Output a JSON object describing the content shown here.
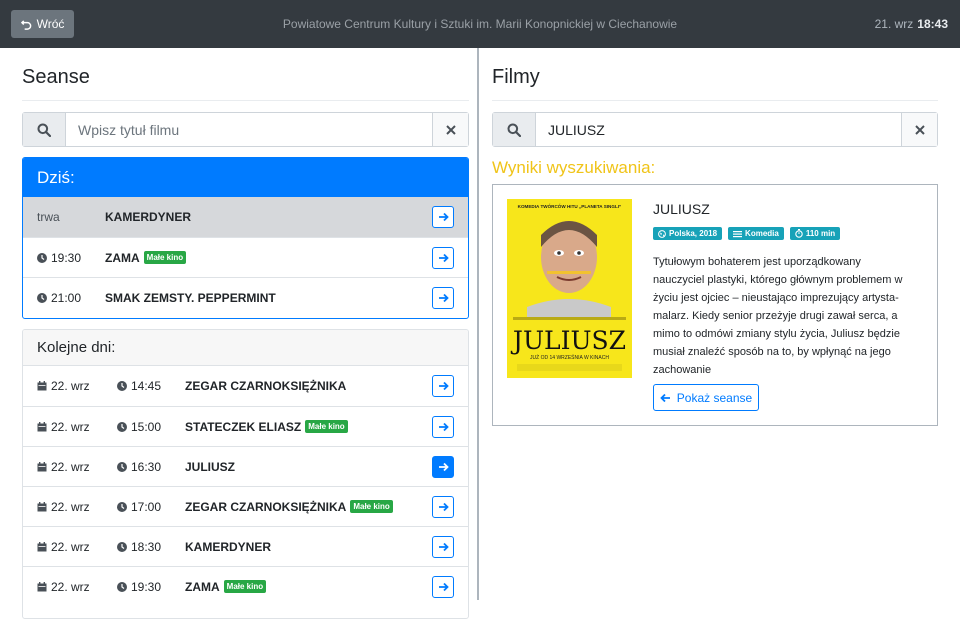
{
  "topbar": {
    "back_label": "Wróć",
    "title": "Powiatowe Centrum Kultury i Sztuki im. Marii Konopnickiej w Ciechanowie",
    "date": "21. wrz",
    "time": "18:43"
  },
  "seanse": {
    "title": "Seanse",
    "search_placeholder": "Wpisz tytuł filmu",
    "today": {
      "header": "Dziś:",
      "rows": [
        {
          "time": "trwa",
          "title": "KAMERDYNER",
          "badge": "",
          "current": true
        },
        {
          "time": "19:30",
          "title": "ZAMA",
          "badge": "Małe kino",
          "current": false
        },
        {
          "time": "21:00",
          "title": "SMAK ZEMSTY. PEPPERMINT",
          "badge": "",
          "current": false
        }
      ]
    },
    "next_days": {
      "header": "Kolejne dni:",
      "rows": [
        {
          "date": "22. wrz",
          "time": "14:45",
          "title": "ZEGAR CZARNOKSIĘŻNIKA",
          "badge": "",
          "active": false
        },
        {
          "date": "22. wrz",
          "time": "15:00",
          "title": "STATECZEK ELIASZ",
          "badge": "Małe kino",
          "active": false
        },
        {
          "date": "22. wrz",
          "time": "16:30",
          "title": "JULIUSZ",
          "badge": "",
          "active": true
        },
        {
          "date": "22. wrz",
          "time": "17:00",
          "title": "ZEGAR CZARNOKSIĘŻNIKA",
          "badge": "Małe kino",
          "active": false
        },
        {
          "date": "22. wrz",
          "time": "18:30",
          "title": "KAMERDYNER",
          "badge": "",
          "active": false
        },
        {
          "date": "22. wrz",
          "time": "19:30",
          "title": "ZAMA",
          "badge": "Małe kino",
          "active": false
        }
      ]
    }
  },
  "filmy": {
    "title": "Filmy",
    "search_value": "JULIUSZ",
    "results_title": "Wyniki wyszukiwania:",
    "result": {
      "title": "JULIUSZ",
      "country_year": "Polska, 2018",
      "genre": "Komedia",
      "duration": "110 min",
      "description": "Tytułowym bohaterem jest uporządkowany nauczyciel plastyki, którego głównym problemem w życiu jest ojciec – nieustająco imprezujący artysta-malarz. Kiedy senior przeżyje drugi zawał serca, a mimo to odmówi zmiany stylu życia, Juliusz będzie musiał znaleźć sposób na to, by wpłynąć na jego zachowanie",
      "show_button": "Pokaż seanse",
      "poster": {
        "tagline": "KOMEDIA TWÓRCÓW HITU „PLANETA SINGLI”",
        "title": "JULIUSZ",
        "release": "JUŻ OD 14 WRZEŚNIA W KINACH"
      }
    }
  },
  "colors": {
    "primary": "#007bff",
    "success": "#28a745",
    "info": "#17a2b8",
    "results_heading": "#f0c419",
    "topbar": "#343a40"
  }
}
